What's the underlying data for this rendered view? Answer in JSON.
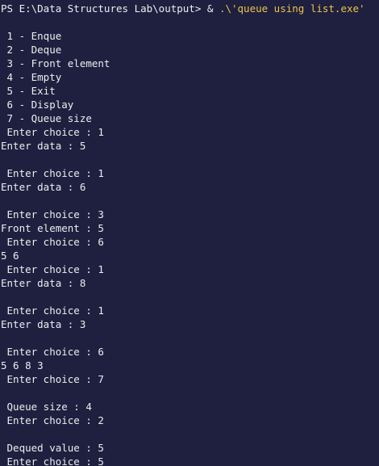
{
  "prompt": {
    "path": "PS E:\\Data Structures Lab\\output> ",
    "op": "& ",
    "arg": ".\\'queue using list.exe'"
  },
  "lines": [
    "",
    " 1 - Enque",
    " 2 - Deque",
    " 3 - Front element",
    " 4 - Empty",
    " 5 - Exit",
    " 6 - Display",
    " 7 - Queue size",
    " Enter choice : 1",
    "Enter data : 5",
    "",
    " Enter choice : 1",
    "Enter data : 6",
    "",
    " Enter choice : 3",
    "Front element : 5",
    " Enter choice : 6",
    "5 6",
    " Enter choice : 1",
    "Enter data : 8",
    "",
    " Enter choice : 1",
    "Enter data : 3",
    "",
    " Enter choice : 6",
    "5 6 8 3",
    " Enter choice : 7",
    "",
    " Queue size : 4",
    " Enter choice : 2",
    "",
    " Dequed value : 5",
    " Enter choice : 5"
  ],
  "colors": {
    "background": "#1f1f40",
    "text": "#eeeeee",
    "argument": "#e8c548"
  }
}
